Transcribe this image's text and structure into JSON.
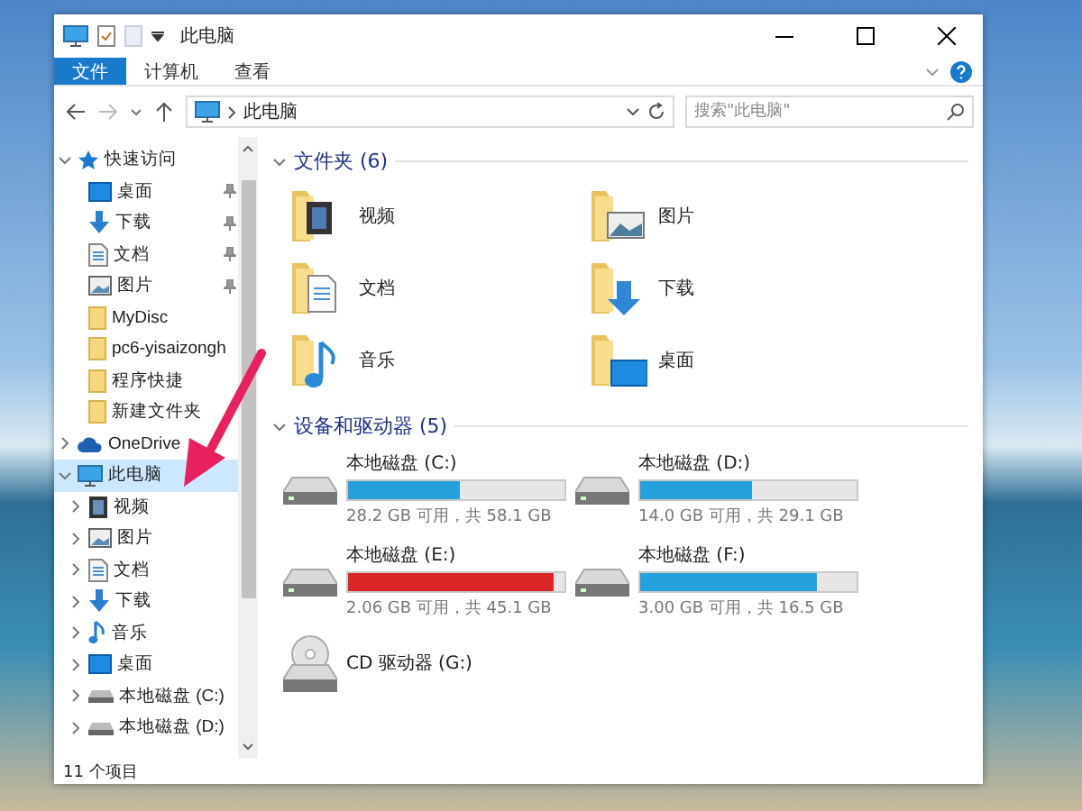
{
  "window": {
    "title": "此电脑"
  },
  "ribbon_tabs": [
    {
      "label": "文件",
      "selected": true
    },
    {
      "label": "计算机",
      "selected": false
    },
    {
      "label": "查看",
      "selected": false
    }
  ],
  "address_bar": {
    "path": "此电脑"
  },
  "search": {
    "placeholder": "搜索\"此电脑\""
  },
  "navigation": [
    {
      "label": "快速访问",
      "kind": "star",
      "expanded": true,
      "selected": false,
      "children": [
        {
          "label": "桌面",
          "kind": "desktop",
          "pinned": true
        },
        {
          "label": "下载",
          "kind": "download",
          "pinned": true
        },
        {
          "label": "文档",
          "kind": "document",
          "pinned": true
        },
        {
          "label": "图片",
          "kind": "picture",
          "pinned": true
        },
        {
          "label": "MyDisc",
          "kind": "folder",
          "pinned": false
        },
        {
          "label": "pc6-yisaizongh",
          "kind": "folder",
          "pinned": false
        },
        {
          "label": "程序快捷",
          "kind": "folder",
          "pinned": false
        },
        {
          "label": "新建文件夹",
          "kind": "folder",
          "pinned": false
        }
      ]
    },
    {
      "label": "OneDrive",
      "kind": "cloud",
      "expanded": false,
      "selected": false
    },
    {
      "label": "此电脑",
      "kind": "pc",
      "expanded": true,
      "selected": true,
      "children": [
        {
          "label": "视频",
          "kind": "video",
          "expanded": false
        },
        {
          "label": "图片",
          "kind": "picture",
          "expanded": false
        },
        {
          "label": "文档",
          "kind": "document",
          "expanded": false
        },
        {
          "label": "下载",
          "kind": "download",
          "expanded": false
        },
        {
          "label": "音乐",
          "kind": "music",
          "expanded": false
        },
        {
          "label": "桌面",
          "kind": "desktop",
          "expanded": false
        },
        {
          "label": "本地磁盘 (C:)",
          "kind": "drive",
          "expanded": false
        },
        {
          "label": "本地磁盘 (D:)",
          "kind": "drive",
          "expanded": false
        }
      ]
    }
  ],
  "folders": {
    "title": "文件夹 (6)",
    "expanded": true,
    "items": [
      {
        "label": "视频",
        "kind": "video"
      },
      {
        "label": "图片",
        "kind": "picture"
      },
      {
        "label": "文档",
        "kind": "document"
      },
      {
        "label": "下载",
        "kind": "download"
      },
      {
        "label": "音乐",
        "kind": "music"
      },
      {
        "label": "桌面",
        "kind": "desktop"
      }
    ]
  },
  "drives": {
    "title": "设备和驱动器 (5)",
    "expanded": true,
    "items": [
      {
        "name": "本地磁盘 (C:)",
        "kind": "disk",
        "free": "28.2 GB 可用，共 58.1 GB",
        "level": 0.515,
        "warning": false
      },
      {
        "name": "本地磁盘 (D:)",
        "kind": "disk",
        "free": "14.0 GB 可用，共 29.1 GB",
        "level": 0.52,
        "warning": false
      },
      {
        "name": "本地磁盘 (E:)",
        "kind": "disk",
        "free": "2.06 GB 可用，共 45.1 GB",
        "level": 0.954,
        "warning": true
      },
      {
        "name": "本地磁盘 (F:)",
        "kind": "disk",
        "free": "3.00 GB 可用，共 16.5 GB",
        "level": 0.82,
        "warning": false
      },
      {
        "name": "CD 驱动器 (G:)",
        "kind": "cd"
      }
    ]
  },
  "status_bar": {
    "count": "11 个项目"
  }
}
